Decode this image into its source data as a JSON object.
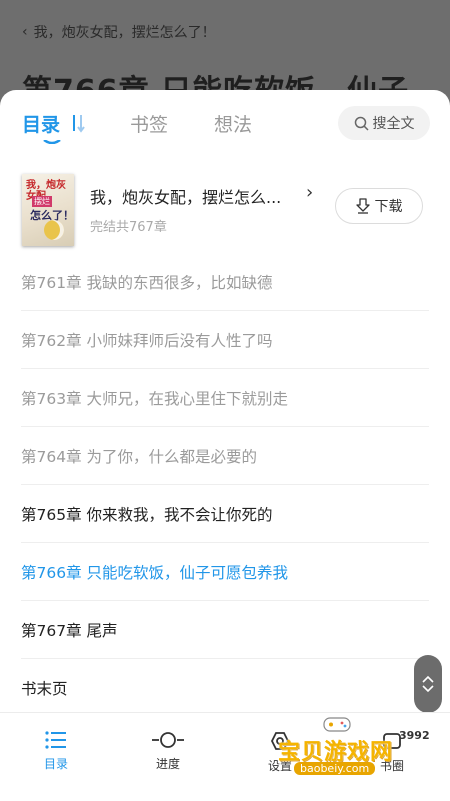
{
  "reader": {
    "book_title_header": "我，炮灰女配，摆烂怎么了！",
    "chapter_heading": "第766章 只能吃软饭，仙子"
  },
  "tabs": [
    {
      "label": "目录",
      "active": true
    },
    {
      "label": "书签",
      "active": false
    },
    {
      "label": "想法",
      "active": false
    }
  ],
  "search": {
    "label": "搜全文"
  },
  "book": {
    "title": "我，炮灰女配，摆烂怎么...",
    "status": "完结共767章",
    "cover_text": [
      "我，炮灰女配",
      "摆烂",
      "怎么了！"
    ],
    "download_label": "下载"
  },
  "chapters": [
    {
      "label": "第761章 我缺的东西很多，比如缺德",
      "state": "unread"
    },
    {
      "label": "第762章 小师妹拜师后没有人性了吗",
      "state": "unread"
    },
    {
      "label": "第763章 大师兄，在我心里住下就别走",
      "state": "unread"
    },
    {
      "label": "第764章 为了你，什么都是必要的",
      "state": "unread"
    },
    {
      "label": "第765章 你来救我，我不会让你死的",
      "state": "read"
    },
    {
      "label": "第766章 只能吃软饭，仙子可愿包养我",
      "state": "current"
    },
    {
      "label": "第767章 尾声",
      "state": "read"
    },
    {
      "label": "书末页",
      "state": "read"
    }
  ],
  "bottom_nav": {
    "contents": "目录",
    "progress": "进度",
    "settings": "设置",
    "circle": "书圈",
    "circle_badge": "3992"
  },
  "watermark": {
    "main": "宝贝游戏网",
    "sub": "baobeiy.com"
  },
  "colors": {
    "accent": "#2196e8",
    "dim_overlay": "#6e6e6e",
    "watermark": "#f5b400"
  }
}
